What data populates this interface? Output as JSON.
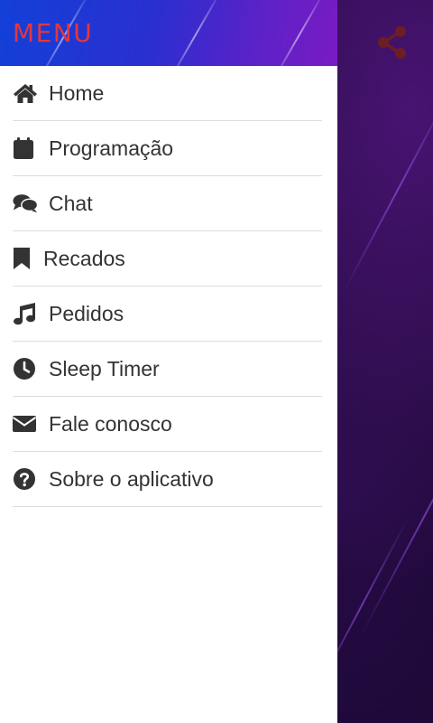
{
  "colors": {
    "header_gradient_start": "#1340d8",
    "header_gradient_end": "#7a1bc2",
    "title_color": "#e4363d",
    "menu_text": "#333333",
    "icon_color": "#333333",
    "share_icon_color": "#6b1f24",
    "background_dark": "#12061f"
  },
  "drawer": {
    "title": "MENU",
    "items": [
      {
        "label": "Home",
        "icon": "home-icon"
      },
      {
        "label": "Programação",
        "icon": "calendar-icon"
      },
      {
        "label": "Chat",
        "icon": "chat-bubbles-icon"
      },
      {
        "label": "Recados",
        "icon": "bookmark-icon"
      },
      {
        "label": "Pedidos",
        "icon": "music-note-icon"
      },
      {
        "label": "Sleep Timer",
        "icon": "clock-icon"
      },
      {
        "label": "Fale conosco",
        "icon": "envelope-icon"
      },
      {
        "label": "Sobre o aplicativo",
        "icon": "question-circle-icon"
      }
    ]
  },
  "toolbar": {
    "share_icon": "share-icon"
  }
}
